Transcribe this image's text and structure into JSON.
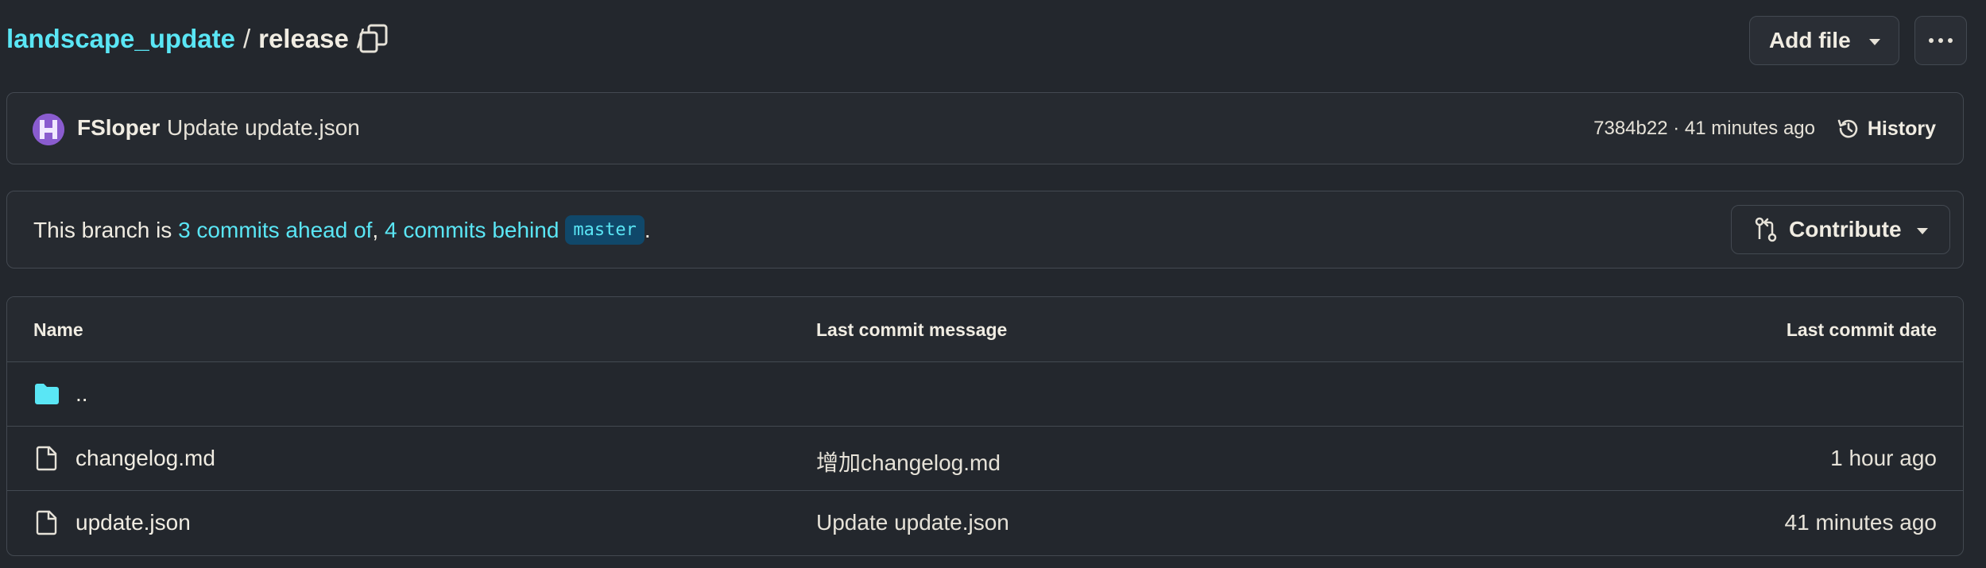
{
  "breadcrumb": {
    "repo": "landscape_update",
    "separator": "/",
    "folder": "release",
    "trailing_separator": "/"
  },
  "header": {
    "add_file_label": "Add file"
  },
  "latest_commit": {
    "author": "FSloper",
    "message": "Update update.json",
    "hash": "7384b22",
    "separator": " · ",
    "time": "41 minutes ago",
    "history_label": "History"
  },
  "branch_status": {
    "prefix": "This branch is ",
    "ahead": "3 commits ahead of",
    "comma": ", ",
    "behind": "4 commits behind",
    "base_branch": "master",
    "suffix": ".",
    "contribute_label": "Contribute"
  },
  "table": {
    "headers": {
      "name": "Name",
      "message": "Last commit message",
      "date": "Last commit date"
    },
    "parent_row": {
      "name": ".."
    },
    "rows": [
      {
        "name": "changelog.md",
        "message": "增加changelog.md",
        "date": "1 hour ago"
      },
      {
        "name": "update.json",
        "message": "Update update.json",
        "date": "41 minutes ago"
      }
    ]
  },
  "colors": {
    "background": "#23272d",
    "accent_link": "#5ae6f5",
    "border": "#434951",
    "branch_pill_bg": "#10486a",
    "avatar_bg": "#8a5ccf"
  },
  "icons": {
    "copy": "copy-icon",
    "folder": "folder-icon",
    "file": "file-icon",
    "history": "history-icon",
    "git_compare": "git-compare-icon",
    "more": "kebab-horizontal-icon"
  }
}
